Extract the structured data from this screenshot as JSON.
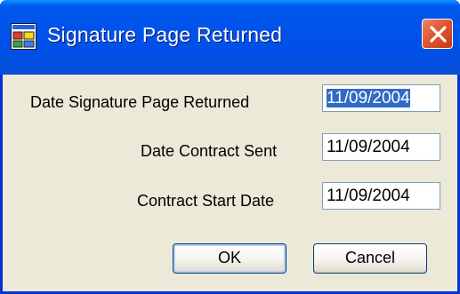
{
  "window": {
    "title": "Signature Page Returned",
    "close_tooltip": "Close"
  },
  "form": {
    "fields": [
      {
        "label": "Date Signature Page Returned",
        "value": "11/09/2004",
        "selected": true
      },
      {
        "label": "Date Contract Sent",
        "value": "11/09/2004",
        "selected": false
      },
      {
        "label": "Contract Start Date",
        "value": "11/09/2004",
        "selected": false
      }
    ]
  },
  "buttons": {
    "ok_label": "OK",
    "cancel_label": "Cancel"
  },
  "colors": {
    "titlebar": "#0054e3",
    "client_background": "#ece9d8",
    "selection": "#316ac5",
    "close_button": "#e05630"
  },
  "icons": {
    "app": "form-window-icon",
    "close": "close-icon"
  }
}
